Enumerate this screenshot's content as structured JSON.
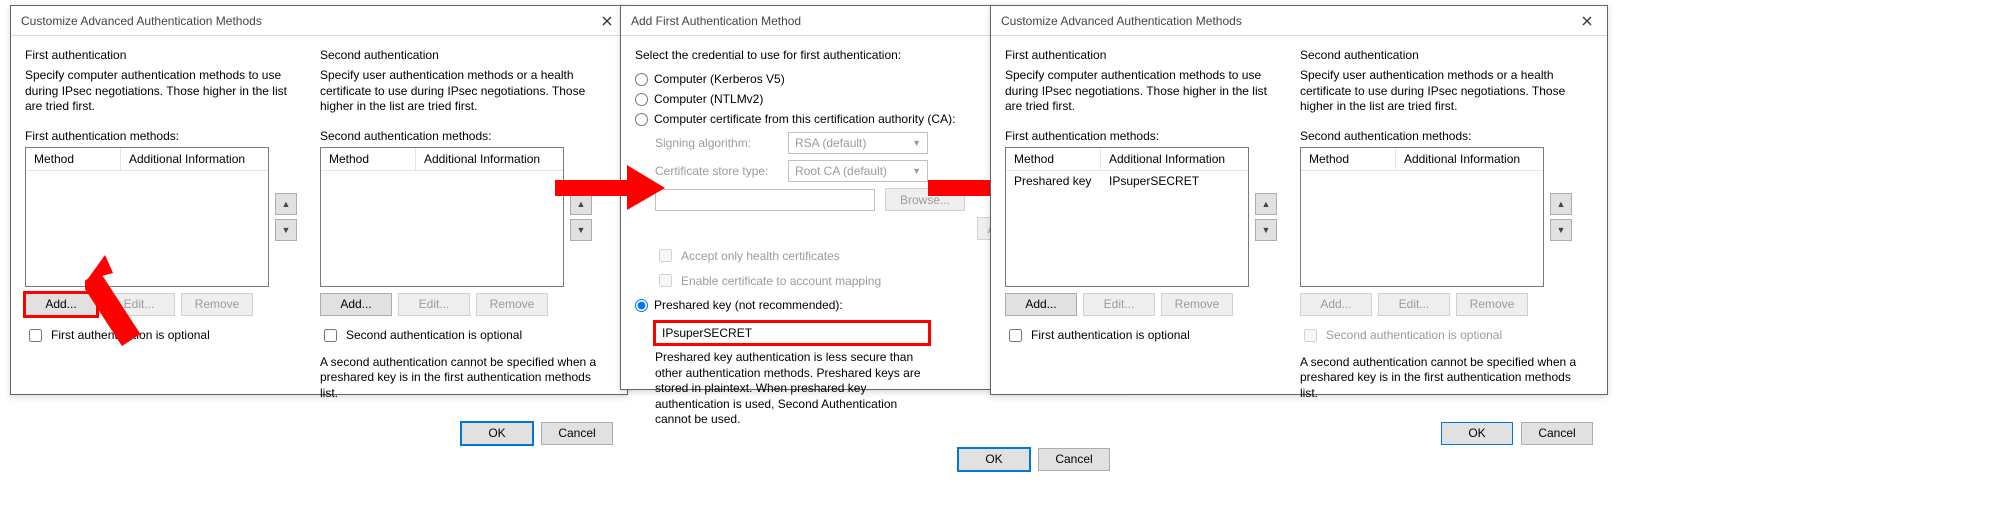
{
  "accent_red": "#ff0000",
  "dialog_customize": {
    "title": "Customize Advanced Authentication Methods",
    "first": {
      "section": "First authentication",
      "desc": "Specify computer authentication methods to use during IPsec negotiations.  Those higher in the list are tried first.",
      "methods_label": "First authentication methods:",
      "col_method": "Method",
      "col_info": "Additional Information",
      "add": "Add...",
      "edit": "Edit...",
      "remove": "Remove",
      "optional_label": "First authentication is optional"
    },
    "second": {
      "section": "Second authentication",
      "desc": "Specify user authentication methods or a health certificate to use during IPsec negotiations.  Those higher in the list are tried first.",
      "methods_label": "Second authentication methods:",
      "col_method": "Method",
      "col_info": "Additional Information",
      "add": "Add...",
      "edit": "Edit...",
      "remove": "Remove",
      "optional_label": "Second authentication is optional",
      "note": "A second authentication cannot be specified when a preshared key is in the first authentication methods list."
    },
    "ok": "OK",
    "cancel": "Cancel"
  },
  "dialog_add": {
    "title": "Add First Authentication Method",
    "instruction": "Select the credential to use for first authentication:",
    "opt_kerberos": "Computer (Kerberos V5)",
    "opt_ntlm": "Computer (NTLMv2)",
    "opt_cert": "Computer certificate from this certification authority (CA):",
    "signing_label": "Signing algorithm:",
    "signing_value": "RSA (default)",
    "store_label": "Certificate store type:",
    "store_value": "Root CA (default)",
    "browse": "Browse...",
    "advanced": "Advanced...",
    "accept_health": "Accept only health certificates",
    "enable_map": "Enable certificate to account mapping",
    "opt_psk": "Preshared key (not recommended):",
    "psk_value": "IPsuperSECRET",
    "psk_desc": "Preshared key authentication is less secure than other authentication methods. Preshared keys are stored in plaintext. When preshared key authentication is used, Second Authentication cannot be used.",
    "ok": "OK",
    "cancel": "Cancel"
  },
  "dialog_customize_filled": {
    "row_method": "Preshared key",
    "row_info": "IPsuperSECRET"
  }
}
